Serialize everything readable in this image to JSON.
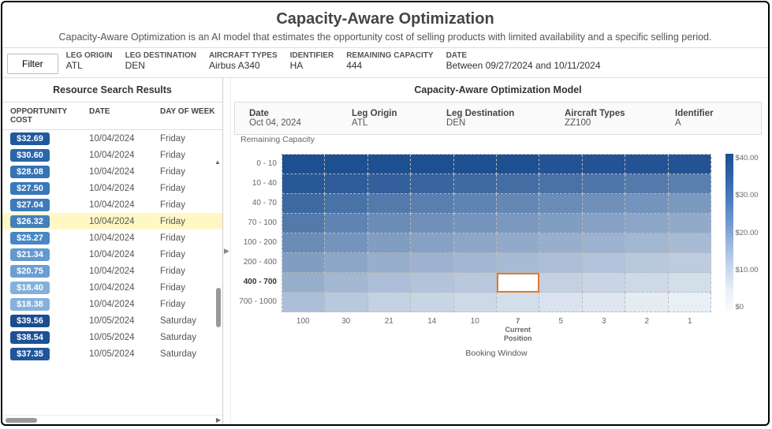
{
  "header": {
    "title": "Capacity-Aware Optimization",
    "subtitle": "Capacity-Aware Optimization is an AI model that estimates the opportunity cost of selling products with limited availability and a specific selling period."
  },
  "filter_button": "Filter",
  "filters": [
    {
      "label": "LEG ORIGIN",
      "value": "ATL"
    },
    {
      "label": "LEG DESTINATION",
      "value": "DEN"
    },
    {
      "label": "AIRCRAFT TYPES",
      "value": "Airbus A340"
    },
    {
      "label": "IDENTIFIER",
      "value": "HA"
    },
    {
      "label": "REMAINING CAPACITY",
      "value": "444"
    },
    {
      "label": "DATE",
      "value": "Between 09/27/2024 and 10/11/2024"
    }
  ],
  "left": {
    "title": "Resource Search Results",
    "columns": {
      "cost": "OPPORTUNITY COST",
      "date": "DATE",
      "dow": "DAY OF WEEK"
    },
    "rows": [
      {
        "cost": "$32.69",
        "date": "10/04/2024",
        "dow": "Friday",
        "color": "#1f5a9e"
      },
      {
        "cost": "$30.60",
        "date": "10/04/2024",
        "dow": "Friday",
        "color": "#2a66ab"
      },
      {
        "cost": "$28.08",
        "date": "10/04/2024",
        "dow": "Friday",
        "color": "#3573b5"
      },
      {
        "cost": "$27.50",
        "date": "10/04/2024",
        "dow": "Friday",
        "color": "#3a78b9"
      },
      {
        "cost": "$27.04",
        "date": "10/04/2024",
        "dow": "Friday",
        "color": "#3d7bbc"
      },
      {
        "cost": "$26.32",
        "date": "10/04/2024",
        "dow": "Friday",
        "color": "#4280bf",
        "highlight": true
      },
      {
        "cost": "$25.27",
        "date": "10/04/2024",
        "dow": "Friday",
        "color": "#4986c3"
      },
      {
        "cost": "$21.34",
        "date": "10/04/2024",
        "dow": "Friday",
        "color": "#6399cf"
      },
      {
        "cost": "$20.75",
        "date": "10/04/2024",
        "dow": "Friday",
        "color": "#6b9fd3"
      },
      {
        "cost": "$18.40",
        "date": "10/04/2024",
        "dow": "Friday",
        "color": "#84b0db"
      },
      {
        "cost": "$18.38",
        "date": "10/04/2024",
        "dow": "Friday",
        "color": "#85b1db"
      },
      {
        "cost": "$39.56",
        "date": "10/05/2024",
        "dow": "Saturday",
        "color": "#1a4d8f"
      },
      {
        "cost": "$38.54",
        "date": "10/05/2024",
        "dow": "Saturday",
        "color": "#1d5194"
      },
      {
        "cost": "$37.35",
        "date": "10/05/2024",
        "dow": "Saturday",
        "color": "#20559a"
      }
    ]
  },
  "right": {
    "title": "Capacity-Aware Optimization Model",
    "info": [
      {
        "label": "Date",
        "value": "Oct 04, 2024"
      },
      {
        "label": "Leg Origin",
        "value": "ATL"
      },
      {
        "label": "Leg Destination",
        "value": "DEN"
      },
      {
        "label": "Aircraft Types",
        "value": "ZZ100"
      },
      {
        "label": "Identifier",
        "value": "A"
      }
    ]
  },
  "chart_data": {
    "type": "heatmap",
    "ylabel": "Remaining Capacity",
    "xlabel": "Booking Window",
    "y_categories": [
      "0 - 10",
      "10 - 40",
      "40 - 70",
      "70 - 100",
      "100 - 200",
      "200 - 400",
      "400 - 700",
      "700 - 1000"
    ],
    "y_highlight_index": 6,
    "x_categories": [
      "100",
      "30",
      "21",
      "14",
      "10",
      "7",
      "5",
      "3",
      "2",
      "1"
    ],
    "x_current_index": 5,
    "x_current_label": "Current Position",
    "highlight_cell": {
      "row": 6,
      "col": 5
    },
    "legend_ticks": [
      "$40.00",
      "$30.00",
      "$20.00",
      "$10.00",
      "$0"
    ],
    "values": [
      [
        40,
        40,
        40,
        40,
        40,
        40,
        39,
        39,
        39,
        39
      ],
      [
        38,
        37,
        36,
        35,
        34,
        33,
        32,
        31,
        30,
        29
      ],
      [
        34,
        32,
        30,
        29,
        28,
        27,
        26,
        25,
        24,
        23
      ],
      [
        30,
        28,
        26,
        25,
        24,
        23,
        22,
        21,
        20,
        19
      ],
      [
        26,
        24,
        22,
        21,
        20,
        19,
        18,
        17,
        16,
        15
      ],
      [
        22,
        20,
        18,
        17,
        16,
        15,
        14,
        13,
        12,
        11
      ],
      [
        18,
        16,
        14,
        13,
        12,
        11,
        10,
        9,
        8,
        7
      ],
      [
        14,
        12,
        10,
        9,
        8,
        7,
        6,
        5,
        4,
        3
      ]
    ]
  }
}
